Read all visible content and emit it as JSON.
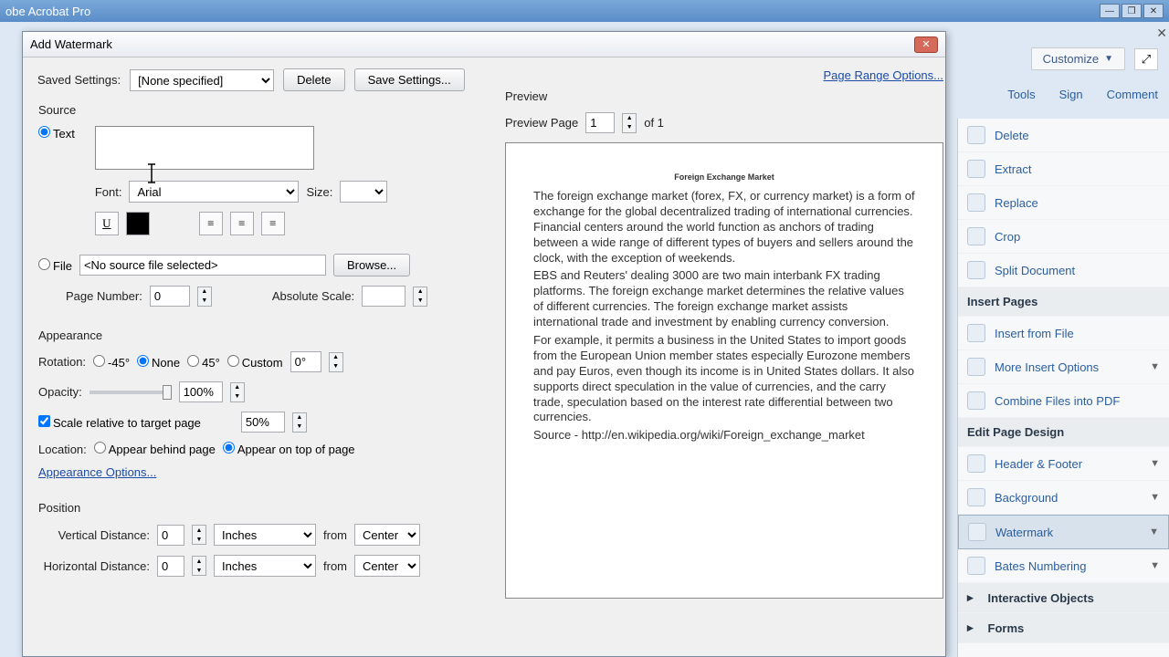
{
  "app": {
    "title": "obe Acrobat Pro"
  },
  "winbtns": {
    "min": "—",
    "max": "❐",
    "close": "✕"
  },
  "mainbar": {
    "customize": "Customize",
    "tools": "Tools",
    "sign": "Sign",
    "comment": "Comment"
  },
  "side": {
    "delete": "Delete",
    "extract": "Extract",
    "replace": "Replace",
    "crop": "Crop",
    "split": "Split Document",
    "insert_head": "Insert Pages",
    "insert_file": "Insert from File",
    "more_insert": "More Insert Options",
    "combine": "Combine Files into PDF",
    "design_head": "Edit Page Design",
    "header_footer": "Header & Footer",
    "background": "Background",
    "watermark": "Watermark",
    "bates": "Bates Numbering",
    "interactive": "Interactive Objects",
    "forms": "Forms"
  },
  "dlg": {
    "title": "Add Watermark",
    "saved_label": "Saved Settings:",
    "saved_value": "[None specified]",
    "delete_btn": "Delete",
    "save_btn": "Save Settings...",
    "page_range": "Page Range Options...",
    "source": "Source",
    "text": "Text",
    "font_label": "Font:",
    "font_value": "Arial",
    "size_label": "Size:",
    "file": "File",
    "file_value": "<No source file selected>",
    "browse": "Browse...",
    "page_num_label": "Page Number:",
    "page_num_value": "0",
    "abs_scale": "Absolute Scale:",
    "appearance": "Appearance",
    "rotation": "Rotation:",
    "rot_m45": "-45°",
    "rot_none": "None",
    "rot_45": "45°",
    "rot_custom": "Custom",
    "rot_val": "0°",
    "opacity": "Opacity:",
    "opacity_val": "100%",
    "scale_rel": "Scale relative to target page",
    "scale_val": "50%",
    "location": "Location:",
    "loc_behind": "Appear behind page",
    "loc_top": "Appear on top of page",
    "appear_opts": "Appearance Options...",
    "position": "Position",
    "vdist": "Vertical Distance:",
    "hdist": "Horizontal Distance:",
    "dist_val": "0",
    "unit": "Inches",
    "from": "from",
    "from_val": "Center",
    "preview": "Preview",
    "preview_page": "Preview Page",
    "preview_val": "1",
    "of": "of 1"
  },
  "doc": {
    "title": "Foreign Exchange Market",
    "p1": "The foreign exchange market (forex, FX, or currency market) is a form of exchange for the global decentralized trading of international currencies. Financial centers around the world function as anchors of trading between a wide range of different types of buyers and sellers around the clock, with the exception of weekends.",
    "p2": "EBS and Reuters' dealing 3000 are two main interbank FX trading platforms. The foreign exchange market determines the relative values of different currencies. The foreign exchange market assists international trade and investment by enabling currency conversion.",
    "p3": "For example, it permits a business in the United States to import goods from the European Union member states especially Eurozone members and pay Euros, even though its income is in United States dollars. It also supports direct speculation in the value of currencies, and the carry trade, speculation based on the interest rate differential between two currencies.",
    "p4": "Source - http://en.wikipedia.org/wiki/Foreign_exchange_market"
  }
}
